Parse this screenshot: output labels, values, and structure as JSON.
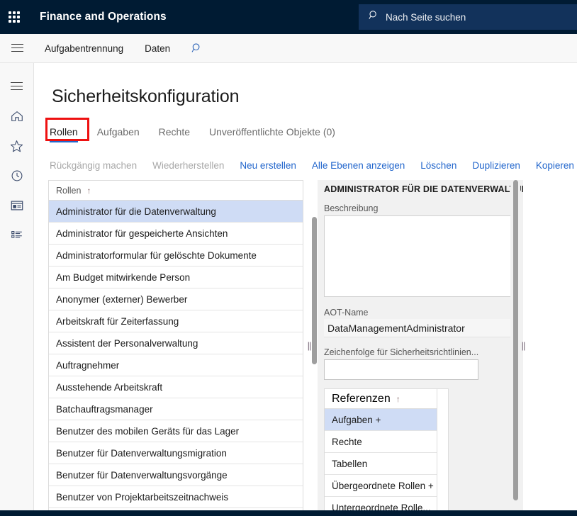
{
  "topbar": {
    "waffle_icon": "app-launcher-icon",
    "app_title": "Finance and Operations",
    "search": {
      "icon": "search-icon",
      "placeholder": "Nach Seite suchen",
      "value": ""
    }
  },
  "actionbar": {
    "hamburger_icon": "hamburger-menu-icon",
    "items": [
      {
        "label": "Aufgabentrennung"
      },
      {
        "label": "Daten"
      }
    ],
    "search_icon": "search-icon"
  },
  "rail": {
    "items": [
      {
        "name": "hamburger-menu-icon",
        "label": "Menü"
      },
      {
        "name": "home-icon",
        "label": "Startseite"
      },
      {
        "name": "star-icon",
        "label": "Favoriten"
      },
      {
        "name": "clock-icon",
        "label": "Zuletzt verwendet"
      },
      {
        "name": "workspace-icon",
        "label": "Arbeitsbereiche"
      },
      {
        "name": "modules-list-icon",
        "label": "Module"
      }
    ]
  },
  "page": {
    "title": "Sicherheitskonfiguration",
    "tabs": [
      {
        "label": "Rollen",
        "active": true,
        "highlighted": true
      },
      {
        "label": "Aufgaben",
        "active": false,
        "highlighted": false
      },
      {
        "label": "Rechte",
        "active": false,
        "highlighted": false
      },
      {
        "label": "Unveröffentlichte Objekte (0)",
        "active": false,
        "highlighted": false
      }
    ],
    "highlight_color": "#ee1111",
    "accent_color": "#2266cc"
  },
  "toolbar": {
    "buttons": [
      {
        "label": "Rückgängig machen",
        "disabled": true
      },
      {
        "label": "Wiederherstellen",
        "disabled": true
      },
      {
        "label": "Neu erstellen",
        "disabled": false
      },
      {
        "label": "Alle Ebenen anzeigen",
        "disabled": false
      },
      {
        "label": "Löschen",
        "disabled": false
      },
      {
        "label": "Duplizieren",
        "disabled": false
      },
      {
        "label": "Kopieren",
        "disabled": false
      }
    ]
  },
  "roles_grid": {
    "header": "Rollen",
    "sort_indicator": "↑",
    "rows": [
      {
        "label": "Administrator für die Datenverwaltung",
        "selected": true
      },
      {
        "label": "Administrator für gespeicherte Ansichten",
        "selected": false
      },
      {
        "label": "Administratorformular für gelöschte Dokumente",
        "selected": false
      },
      {
        "label": "Am Budget mitwirkende Person",
        "selected": false
      },
      {
        "label": "Anonymer (externer) Bewerber",
        "selected": false
      },
      {
        "label": "Arbeitskraft für Zeiterfassung",
        "selected": false
      },
      {
        "label": "Assistent der Personalverwaltung",
        "selected": false
      },
      {
        "label": "Auftragnehmer",
        "selected": false
      },
      {
        "label": "Ausstehende Arbeitskraft",
        "selected": false
      },
      {
        "label": "Batchauftragsmanager",
        "selected": false
      },
      {
        "label": "Benutzer des mobilen Geräts für das Lager",
        "selected": false
      },
      {
        "label": "Benutzer für Datenverwaltungsmigration",
        "selected": false
      },
      {
        "label": "Benutzer für Datenverwaltungsvorgänge",
        "selected": false
      },
      {
        "label": "Benutzer von Projektarbeitszeitnachweis",
        "selected": false
      }
    ]
  },
  "detail_pane": {
    "title": "ADMINISTRATOR FÜR DIE DATENVERWALTUNG",
    "description_label": "Beschreibung",
    "description_value": "",
    "aot_name_label": "AOT-Name",
    "aot_name_value": "DataManagementAdministrator",
    "policy_sequence_label": "Zeichenfolge für Sicherheitsrichtlinien...",
    "policy_sequence_value": "",
    "references_grid": {
      "header": "Referenzen",
      "sort_indicator": "↑",
      "rows": [
        {
          "label": "Aufgaben +",
          "selected": true
        },
        {
          "label": "Rechte",
          "selected": false
        },
        {
          "label": "Tabellen",
          "selected": false
        },
        {
          "label": "Übergeordnete Rollen +",
          "selected": false
        },
        {
          "label": "Untergeordnete Rolle...",
          "selected": false
        }
      ]
    }
  },
  "splitters": [
    {
      "name": "list-detail-splitter",
      "grip": "||"
    },
    {
      "name": "detail-right-splitter",
      "grip": "||"
    }
  ]
}
